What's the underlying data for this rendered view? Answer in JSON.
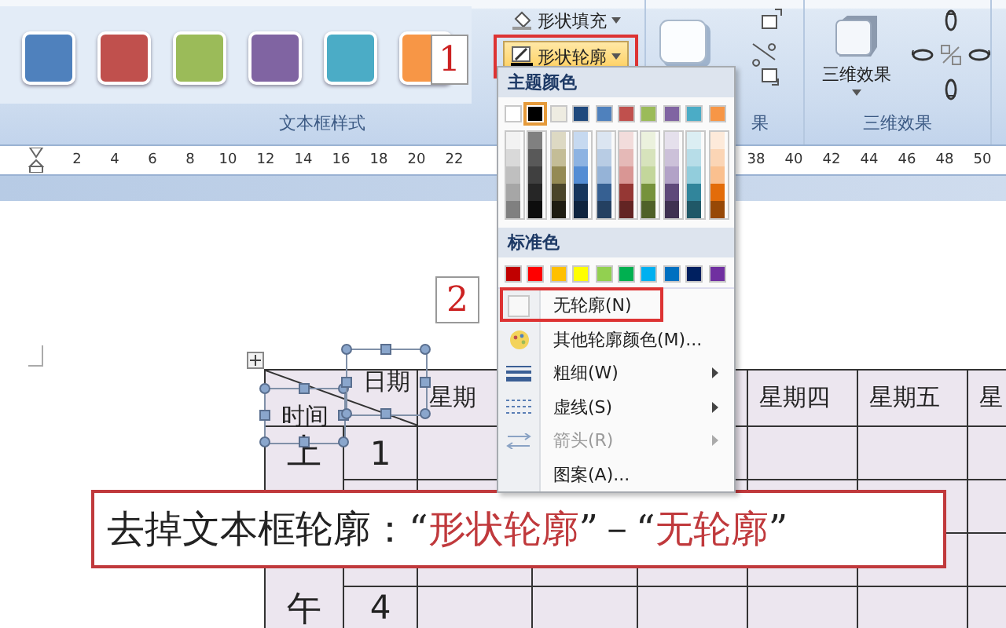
{
  "ribbon": {
    "text_box_styles": {
      "label": "文本框样式",
      "swatches": [
        {
          "color": "#4f81bd"
        },
        {
          "color": "#c0504d"
        },
        {
          "color": "#9bbb59"
        },
        {
          "color": "#8064a2"
        },
        {
          "color": "#4bacc6"
        },
        {
          "color": "#f79646"
        }
      ]
    },
    "shape_buttons": [
      {
        "label": "形状填充",
        "kind": "fill",
        "open": false
      },
      {
        "label": "形状轮廓",
        "kind": "outline",
        "open": true,
        "callout": "1"
      }
    ],
    "shadow_group": {
      "label": "果"
    },
    "three_d_group": {
      "label": "三维效果",
      "button": "三维效果"
    }
  },
  "ruler": {
    "left_numbers": [
      "2",
      "4",
      "6",
      "8",
      "10",
      "12",
      "14",
      "16",
      "18",
      "20",
      "22"
    ],
    "right_numbers": [
      "38",
      "40",
      "42",
      "44",
      "46",
      "48",
      "50"
    ]
  },
  "outline_menu": {
    "theme_title": "主题颜色",
    "theme_colors": [
      {
        "color": "#ffffff",
        "selected": false,
        "shades": [
          {
            "color": "#f2f2f2"
          },
          {
            "color": "#d9d9d9"
          },
          {
            "color": "#bfbfbf"
          },
          {
            "color": "#a6a6a6"
          },
          {
            "color": "#808080"
          }
        ]
      },
      {
        "color": "#000000",
        "selected": true,
        "shades": [
          {
            "color": "#808080"
          },
          {
            "color": "#595959"
          },
          {
            "color": "#404040"
          },
          {
            "color": "#262626"
          },
          {
            "color": "#0d0d0d"
          }
        ]
      },
      {
        "color": "#eeece1",
        "selected": false,
        "shades": [
          {
            "color": "#ddd9c3"
          },
          {
            "color": "#c4bd97"
          },
          {
            "color": "#948a54"
          },
          {
            "color": "#4a452a"
          },
          {
            "color": "#1e1c11"
          }
        ]
      },
      {
        "color": "#1f497d",
        "selected": false,
        "shades": [
          {
            "color": "#c6d9f0"
          },
          {
            "color": "#8db3e2"
          },
          {
            "color": "#548dd4"
          },
          {
            "color": "#17365d"
          },
          {
            "color": "#0f243e"
          }
        ]
      },
      {
        "color": "#4f81bd",
        "selected": false,
        "shades": [
          {
            "color": "#dbe5f1"
          },
          {
            "color": "#b8cce4"
          },
          {
            "color": "#95b3d7"
          },
          {
            "color": "#366092"
          },
          {
            "color": "#244061"
          }
        ]
      },
      {
        "color": "#c0504d",
        "selected": false,
        "shades": [
          {
            "color": "#f2dcdb"
          },
          {
            "color": "#e5b9b7"
          },
          {
            "color": "#d99694"
          },
          {
            "color": "#953734"
          },
          {
            "color": "#632423"
          }
        ]
      },
      {
        "color": "#9bbb59",
        "selected": false,
        "shades": [
          {
            "color": "#ebf1dd"
          },
          {
            "color": "#d7e3bc"
          },
          {
            "color": "#c3d69b"
          },
          {
            "color": "#76923c"
          },
          {
            "color": "#4f6128"
          }
        ]
      },
      {
        "color": "#8064a2",
        "selected": false,
        "shades": [
          {
            "color": "#e5e0ec"
          },
          {
            "color": "#ccc1d9"
          },
          {
            "color": "#b2a2c7"
          },
          {
            "color": "#5f497a"
          },
          {
            "color": "#3f3151"
          }
        ]
      },
      {
        "color": "#4bacc6",
        "selected": false,
        "shades": [
          {
            "color": "#dbeef3"
          },
          {
            "color": "#b7dde8"
          },
          {
            "color": "#92cddc"
          },
          {
            "color": "#31859b"
          },
          {
            "color": "#205867"
          }
        ]
      },
      {
        "color": "#f79646",
        "selected": false,
        "shades": [
          {
            "color": "#fdeada"
          },
          {
            "color": "#fbd5b5"
          },
          {
            "color": "#fac08f"
          },
          {
            "color": "#e36c09"
          },
          {
            "color": "#974806"
          }
        ]
      }
    ],
    "standard_title": "标准色",
    "standard_colors": [
      {
        "color": "#c00000"
      },
      {
        "color": "#ff0000"
      },
      {
        "color": "#ffc000"
      },
      {
        "color": "#ffff00"
      },
      {
        "color": "#92d050"
      },
      {
        "color": "#00b050"
      },
      {
        "color": "#00b0f0"
      },
      {
        "color": "#0070c0"
      },
      {
        "color": "#002060"
      },
      {
        "color": "#7030a0"
      }
    ],
    "items": [
      {
        "label": "无轮廓(N)",
        "kind": "empty",
        "submenu": false,
        "disabled": false,
        "callout": "2"
      },
      {
        "label": "其他轮廓颜色(M)...",
        "kind": "palette",
        "submenu": false,
        "disabled": false
      },
      {
        "label": "粗细(W)",
        "kind": "weight",
        "submenu": true,
        "disabled": false
      },
      {
        "label": "虚线(S)",
        "kind": "dash",
        "submenu": true,
        "disabled": false
      },
      {
        "label": "箭头(R)",
        "kind": "arrows",
        "submenu": true,
        "disabled": true
      },
      {
        "label": "图案(A)...",
        "kind": "plain",
        "submenu": false,
        "disabled": false
      }
    ]
  },
  "table": {
    "columns": [
      {
        "header": "星期"
      },
      {},
      {},
      {
        "header": "星期四"
      },
      {
        "header": "星期五"
      },
      {
        "header": "星"
      }
    ],
    "side_labels": [
      "上",
      "午"
    ],
    "rows": [
      {
        "number": "1"
      },
      {},
      {},
      {
        "number": "4"
      }
    ]
  },
  "text_boxes": [
    {
      "text": "时间"
    },
    {
      "text": "日期"
    }
  ],
  "caption": {
    "parts": [
      {
        "text": "去掉文本框轮廓：",
        "highlight": false
      },
      {
        "text": "“",
        "highlight": false
      },
      {
        "text": "形状轮廓",
        "highlight": true
      },
      {
        "text": "”－“",
        "highlight": false
      },
      {
        "text": "无轮廓",
        "highlight": true
      },
      {
        "text": "”",
        "highlight": false
      }
    ]
  }
}
